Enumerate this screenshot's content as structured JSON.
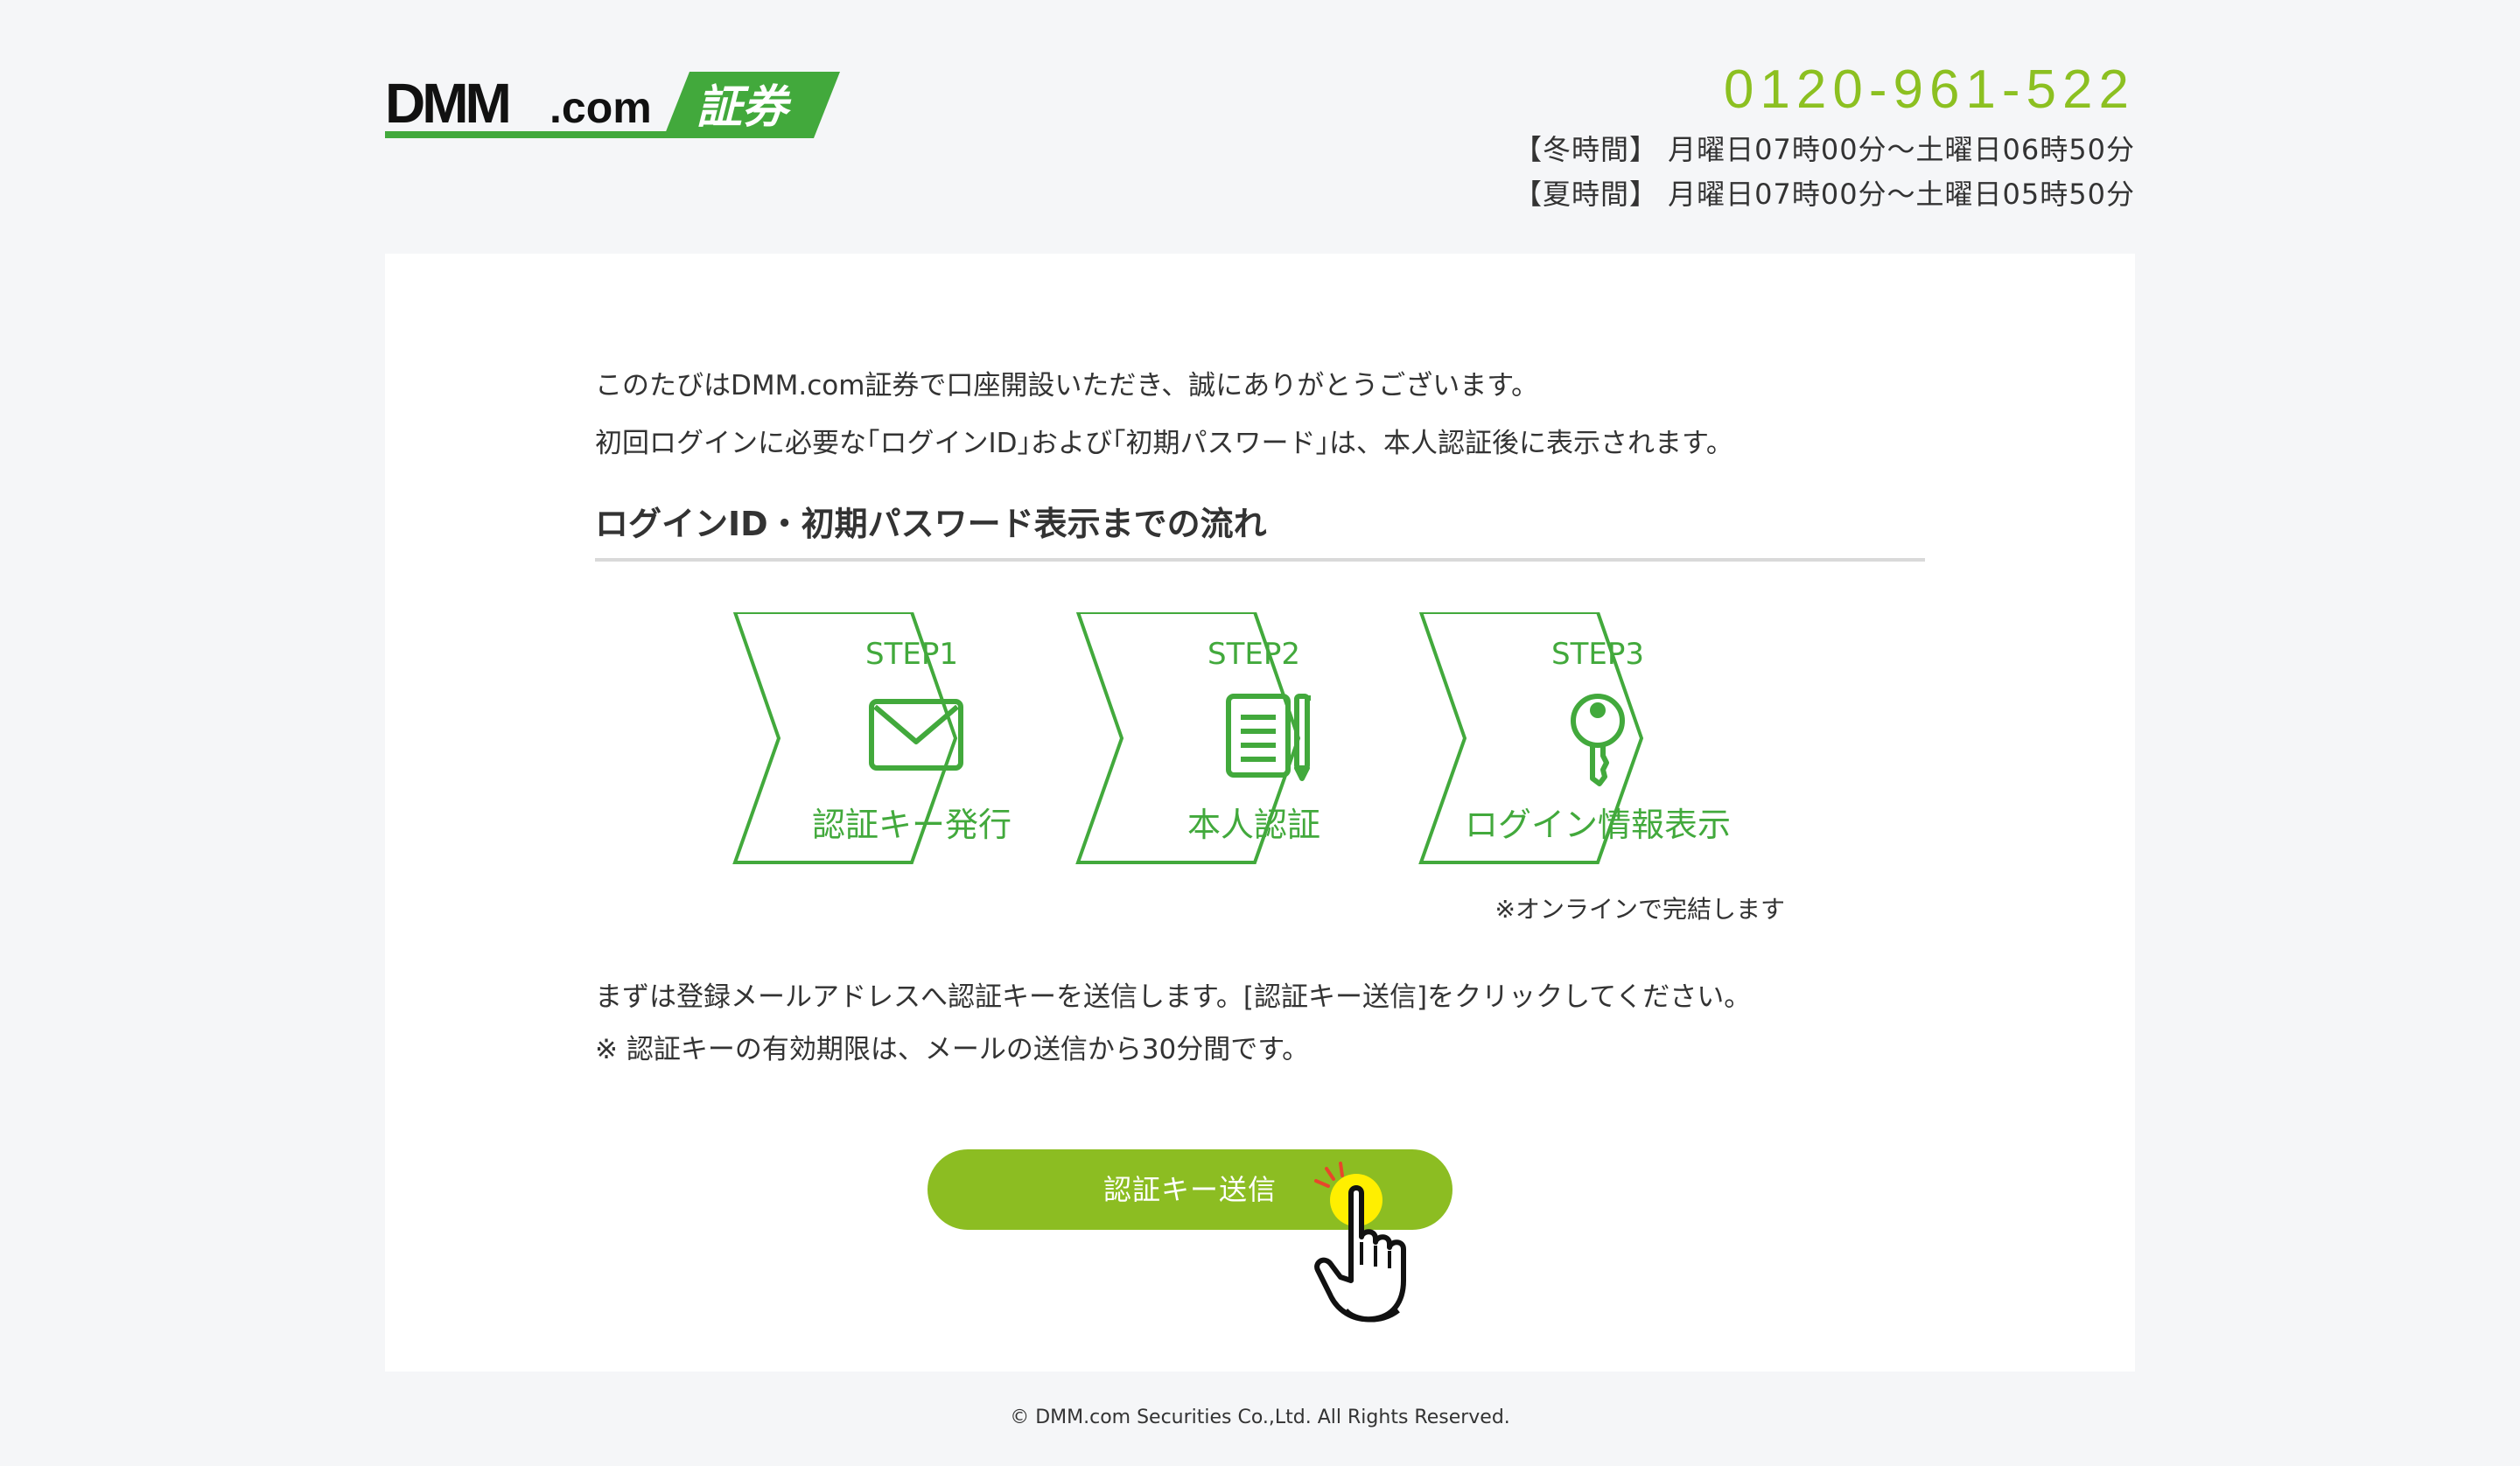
{
  "header": {
    "logo_text": "DMM.com 証券",
    "phone": "0120-961-522",
    "winter_hours": "【冬時間】 月曜日07時00分～土曜日06時50分",
    "summer_hours": "【夏時間】 月曜日07時00分～土曜日05時50分"
  },
  "intro": {
    "line1": "このたびはDMM.com証券で口座開設いただき、誠にありがとうございます。",
    "line2": "初回ログインに必要な｢ログインID｣および｢初期パスワード｣は、本人認証後に表示されます。"
  },
  "section_title": "ログインID・初期パスワード表示までの流れ",
  "steps": [
    {
      "label": "STEP1",
      "name": "認証キー発行",
      "icon": "envelope-icon"
    },
    {
      "label": "STEP2",
      "name": "本人認証",
      "icon": "document-pen-icon"
    },
    {
      "label": "STEP3",
      "name": "ログイン情報表示",
      "icon": "key-icon"
    }
  ],
  "steps_note": "※オンラインで完結します",
  "instructions": {
    "line1": "まずは登録メールアドレスへ認証キーを送信します。[認証キー送信]をクリックしてください。",
    "line2": "※ 認証キーの有効期限は、メールの送信から30分間です。"
  },
  "send_button": "認証キー送信",
  "footer": "© DMM.com Securities Co.,Ltd. All Rights Reserved.",
  "colors": {
    "brand_green": "#42a93c",
    "button_green": "#8cbd22",
    "phone_green": "#8cc021",
    "background": "#f5f6f8"
  }
}
